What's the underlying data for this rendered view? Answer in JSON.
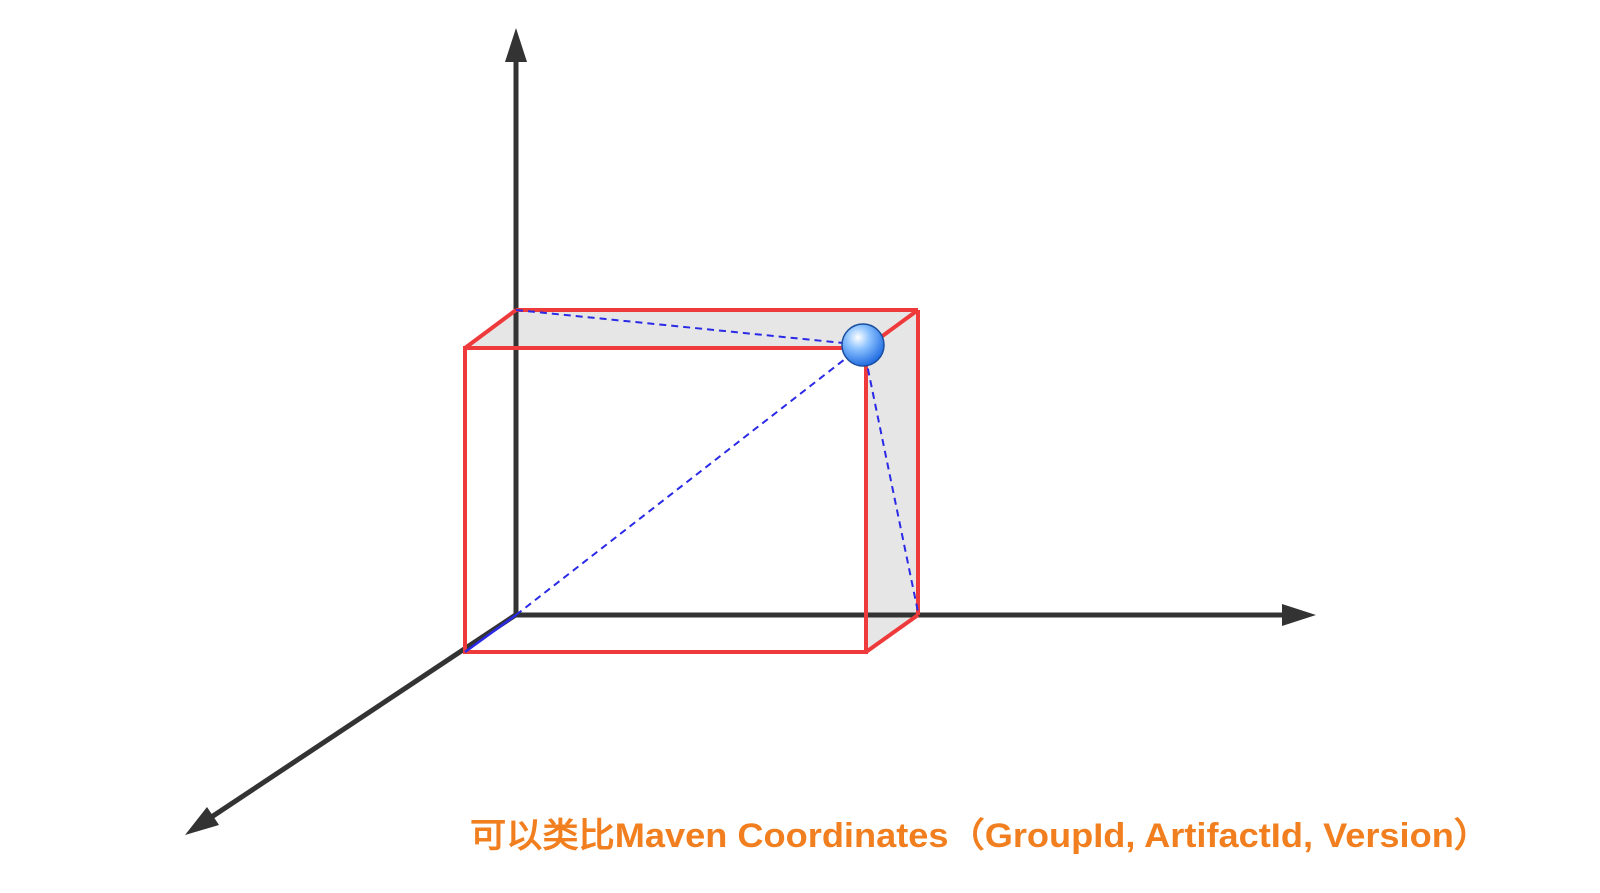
{
  "caption": "可以类比Maven Coordinates（GroupId, ArtifactId, Version）",
  "colors": {
    "axis": "#333333",
    "box_edge": "#ee3a3a",
    "box_face": "#e6e6e6",
    "dashed": "#2a2ae6",
    "point_edge": "#1a4fa0",
    "caption": "#f17f1f"
  }
}
